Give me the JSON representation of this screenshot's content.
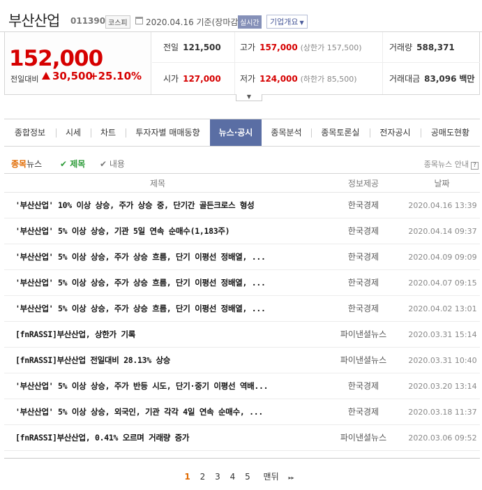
{
  "stock": {
    "name": "부산산업",
    "code": "011390",
    "market": "코스피",
    "date_label": "2020.04.16 기준(장마감)",
    "realtime": "실시간",
    "company_overview": "기업개요"
  },
  "quote": {
    "price": "152,000",
    "prev_label": "전일대비",
    "change": "30,500",
    "change_pct": "+25.10%",
    "prev_close_label": "전일",
    "prev_close": "121,500",
    "high_label": "고가",
    "high": "157,000",
    "upper_limit": "(상한가 157,500)",
    "volume_label": "거래량",
    "volume": "588,371",
    "open_label": "시가",
    "open": "127,000",
    "low_label": "저가",
    "low": "124,000",
    "lower_limit": "(하한가 85,500)",
    "amount_label": "거래대금",
    "amount": "83,096",
    "amount_unit": "백만"
  },
  "tabs": [
    {
      "label": "종합정보"
    },
    {
      "label": "시세"
    },
    {
      "label": "차트"
    },
    {
      "label": "투자자별 매매동향"
    },
    {
      "label": "뉴스·공시"
    },
    {
      "label": "종목분석"
    },
    {
      "label": "종목토론실"
    },
    {
      "label": "전자공시"
    },
    {
      "label": "공매도현황"
    }
  ],
  "subtabs": {
    "section_hl": "종목",
    "section_rest": "뉴스",
    "title_filter": "제목",
    "content_filter": "내용",
    "guide": "종목뉴스 안내",
    "guide_q": "?"
  },
  "table": {
    "headers": {
      "title": "제목",
      "source": "정보제공",
      "date": "날짜"
    },
    "rows": [
      {
        "title": "'부산산업' 10% 이상 상승, 주가 상승 중, 단기간 골든크로스 형성",
        "source": "한국경제",
        "date": "2020.04.16 13:39"
      },
      {
        "title": "'부산산업' 5% 이상 상승, 기관 5일 연속 순매수(1,183주)",
        "source": "한국경제",
        "date": "2020.04.14 09:37"
      },
      {
        "title": "'부산산업' 5% 이상 상승, 주가 상승 흐름, 단기 이평선 정배열, ...",
        "source": "한국경제",
        "date": "2020.04.09 09:09"
      },
      {
        "title": "'부산산업' 5% 이상 상승, 주가 상승 흐름, 단기 이평선 정배열, ...",
        "source": "한국경제",
        "date": "2020.04.07 09:15"
      },
      {
        "title": "'부산산업' 5% 이상 상승, 주가 상승 흐름, 단기 이평선 정배열, ...",
        "source": "한국경제",
        "date": "2020.04.02 13:01"
      },
      {
        "title": "[fnRASSI]부산산업, 상한가 기록",
        "source": "파이낸셜뉴스",
        "date": "2020.03.31 15:14"
      },
      {
        "title": "[fnRASSI]부산산업 전일대비 28.13% 상승",
        "source": "파이낸셜뉴스",
        "date": "2020.03.31 10:40"
      },
      {
        "title": "'부산산업' 5% 이상 상승, 주가 반등 시도, 단기·중기 이평선 역배...",
        "source": "한국경제",
        "date": "2020.03.20 13:14"
      },
      {
        "title": "'부산산업' 5% 이상 상승, 외국인, 기관 각각 4일 연속 순매수, ...",
        "source": "한국경제",
        "date": "2020.03.18 11:37"
      },
      {
        "title": "[fnRASSI]부산산업, 0.41% 오르며 거래량 증가",
        "source": "파이낸셜뉴스",
        "date": "2020.03.06 09:52"
      }
    ]
  },
  "pager": {
    "pages": [
      "1",
      "2",
      "3",
      "4",
      "5"
    ],
    "last": "맨뒤",
    "next": "▸▸"
  },
  "colors": {
    "up": "#d60000",
    "accent": "#5a6ea4",
    "highlight": "#e06a00",
    "check": "#2d9b38"
  }
}
